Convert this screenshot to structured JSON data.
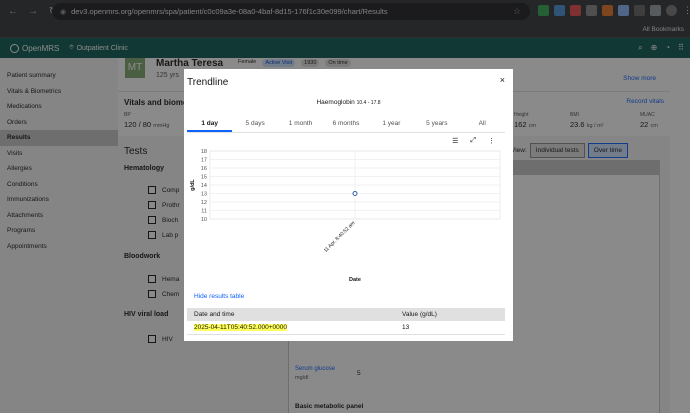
{
  "browser": {
    "url": "dev3.openmrs.org/openmrs/spa/patient/c0c09a3e-08a0-4baf-8d15-176f1c30e099/chart/Results",
    "all_bookmarks": "All Bookmarks"
  },
  "app": {
    "logo": "OpenMRS",
    "location": "Outpatient Clinic"
  },
  "sidebar": {
    "items": [
      "Patient summary",
      "Vitals & Biometrics",
      "Medications",
      "Orders",
      "Results",
      "Visits",
      "Allergies",
      "Conditions",
      "Immunizations",
      "Attachments",
      "Programs",
      "Appointments"
    ],
    "active": "Results"
  },
  "patient": {
    "initials": "MT",
    "name": "Martha Teresa",
    "gender": "Female",
    "status": "Active Visit",
    "id": "1930",
    "chip": "On time",
    "age": "125 yrs",
    "show_more": "Show more"
  },
  "vitals": {
    "title": "Vitals and biometrics",
    "record": "Record vitals",
    "bp_label": "BP",
    "bp_value": "120 / 80",
    "bp_unit": "mmHg",
    "height_label": "Height",
    "height_value": "162",
    "height_unit": "cm",
    "bmi_label": "BMI",
    "bmi_value": "23.6",
    "bmi_unit": "kg / m²",
    "muac_label": "MUAC",
    "muac_value": "22",
    "muac_unit": "cm"
  },
  "tests": {
    "title": "Tests",
    "view_label": "View:",
    "view_individual": "Individual tests",
    "view_over_time": "Over time",
    "groups": [
      "Hematology",
      "Bloodwork",
      "HIV viral load"
    ],
    "hematology_items": [
      "Comp",
      "Prothr",
      "Bioch",
      "Lab p"
    ],
    "bloodwork_items": [
      "Hema",
      "Chem"
    ],
    "hiv_item": "HIV",
    "serum_glucose": "Serum glucose",
    "serum_unit": "mg/dl",
    "serum_value": "5",
    "basic_panel": "Basic metabolic panel"
  },
  "modal": {
    "title": "Trendline",
    "close": "×",
    "chart_heading": "Haemoglobin",
    "reference_range": "10.4 - 17.8",
    "tabs": [
      "1 day",
      "5 days",
      "1 month",
      "6 months",
      "1 year",
      "5 years",
      "All"
    ],
    "active_tab": "1 day",
    "hide_table": "Hide results table",
    "table": {
      "headers": [
        "Date and time",
        "Value (g/dL)"
      ],
      "rows": [
        [
          "2025-04-11T05:40:52.000+0000",
          "13"
        ]
      ]
    }
  },
  "chart_data": {
    "type": "scatter",
    "title": "",
    "xlabel": "Date",
    "ylabel": "g/dL",
    "x": [
      "11 Apr, 8:40:52 am"
    ],
    "values": [
      13
    ],
    "ylim": [
      10,
      18
    ],
    "yticks": [
      10,
      11,
      12,
      13,
      14,
      15,
      16,
      17,
      18
    ],
    "grid": true,
    "point_color": "#3b5ea8"
  }
}
